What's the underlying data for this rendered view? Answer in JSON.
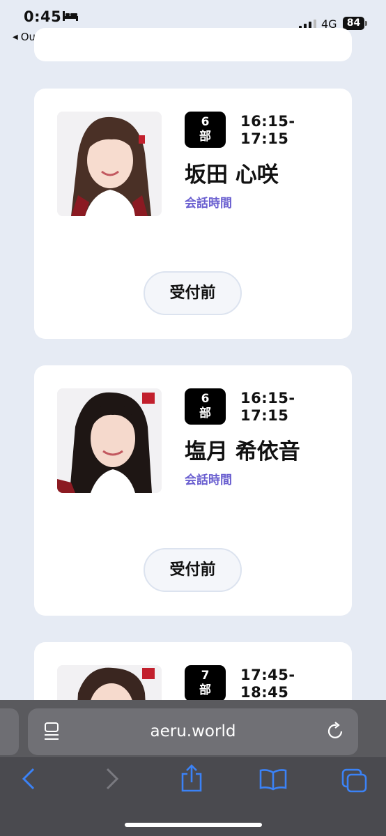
{
  "status_bar": {
    "time": "0:45",
    "back_app": "Outlook",
    "network": "4G",
    "battery": "84"
  },
  "cards": [
    {
      "part": "6\n部",
      "time_start": "16:15-",
      "time_end": "17:15",
      "name": "坂田 心咲",
      "talk_label": "会話時間",
      "status": "受付前"
    },
    {
      "part": "6\n部",
      "time_start": "16:15-",
      "time_end": "17:15",
      "name": "塩月 希依音",
      "talk_label": "会話時間",
      "status": "受付前"
    },
    {
      "part": "7\n部",
      "time_start": "17:45-",
      "time_end": "18:45"
    }
  ],
  "browser": {
    "url": "aeru.world"
  },
  "colors": {
    "page_bg": "#e6ebf4",
    "accent": "#6a5fd0",
    "ios_blue": "#3b82f6"
  }
}
